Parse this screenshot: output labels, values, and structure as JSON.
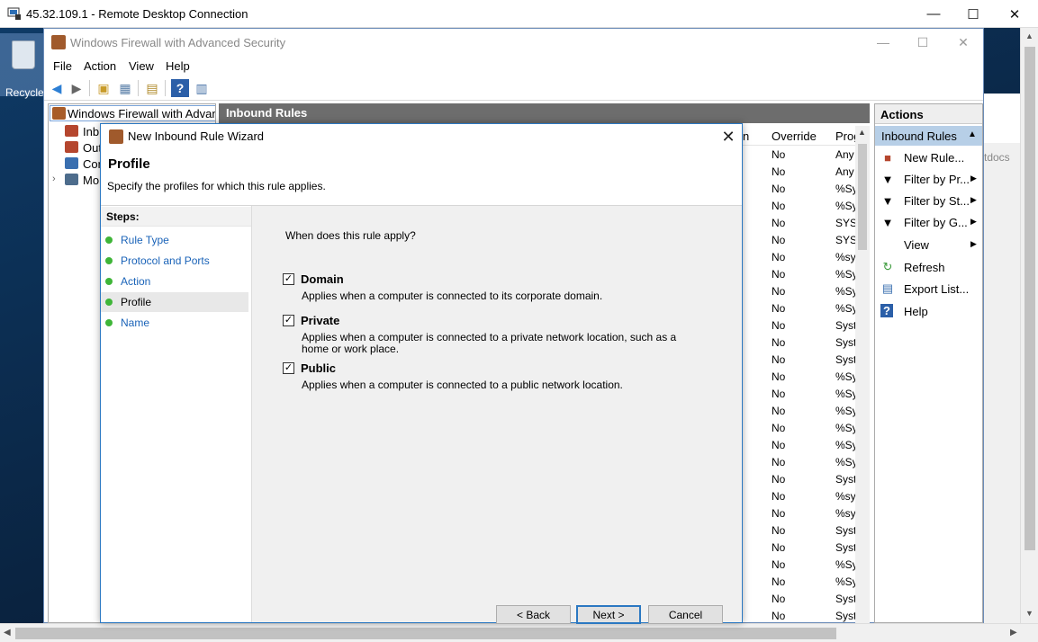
{
  "rdp": {
    "title": "45.32.109.1 - Remote Desktop Connection",
    "min": "—",
    "max": "☐",
    "close": "✕"
  },
  "desktop": {
    "recycle_label": "Recycle",
    "right_strip_text": "tdocs"
  },
  "mmc": {
    "title": "Windows Firewall with Advanced Security",
    "menu": [
      "File",
      "Action",
      "View",
      "Help"
    ],
    "tree": {
      "root": "Windows Firewall with Advance",
      "items": [
        "Inb",
        "Out",
        "Cor",
        "Mo"
      ]
    },
    "center_header": "Inbound Rules",
    "columns": [
      "n",
      "Override",
      "Prog"
    ],
    "rows": [
      [
        "No",
        "Any"
      ],
      [
        "No",
        "Any"
      ],
      [
        "No",
        "%Sy"
      ],
      [
        "No",
        "%Sy"
      ],
      [
        "No",
        "SYST"
      ],
      [
        "No",
        "SYST"
      ],
      [
        "No",
        "%sy"
      ],
      [
        "No",
        "%Sy"
      ],
      [
        "No",
        "%Sy"
      ],
      [
        "No",
        "%Sy"
      ],
      [
        "No",
        "Syst"
      ],
      [
        "No",
        "Syst"
      ],
      [
        "No",
        "Syst"
      ],
      [
        "No",
        "%Sy"
      ],
      [
        "No",
        "%Sy"
      ],
      [
        "No",
        "%Sy"
      ],
      [
        "No",
        "%Sy"
      ],
      [
        "No",
        "%Sy"
      ],
      [
        "No",
        "%Sy"
      ],
      [
        "No",
        "Syst"
      ],
      [
        "No",
        "%sy"
      ],
      [
        "No",
        "%sy"
      ],
      [
        "No",
        "Syst"
      ],
      [
        "No",
        "Syst"
      ],
      [
        "No",
        "%Sy"
      ],
      [
        "No",
        "%Sy"
      ],
      [
        "No",
        "Syst"
      ],
      [
        "No",
        "Syst"
      ]
    ],
    "actions": {
      "title": "Actions",
      "section": "Inbound Rules",
      "items": [
        "New Rule...",
        "Filter by Pr...",
        "Filter by St...",
        "Filter by G...",
        "View",
        "Refresh",
        "Export List...",
        "Help"
      ]
    }
  },
  "wizard": {
    "title": "New Inbound Rule Wizard",
    "heading": "Profile",
    "subheading": "Specify the profiles for which this rule applies.",
    "steps_title": "Steps:",
    "steps": [
      "Rule Type",
      "Protocol and Ports",
      "Action",
      "Profile",
      "Name"
    ],
    "current_step": "Profile",
    "question": "When does this rule apply?",
    "options": [
      {
        "label": "Domain",
        "checked": true,
        "desc": "Applies when a computer is connected to its corporate domain."
      },
      {
        "label": "Private",
        "checked": true,
        "desc": "Applies when a computer is connected to a private network location, such as a home or work place."
      },
      {
        "label": "Public",
        "checked": true,
        "desc": "Applies when a computer is connected to a public network location."
      }
    ],
    "buttons": {
      "back": "< Back",
      "next": "Next >",
      "cancel": "Cancel"
    }
  },
  "colors": {
    "accent": "#2b78c2",
    "step_dot": "#3fb538",
    "step_link": "#1a63b8",
    "section_bg": "#b7cfe7",
    "header_bg": "#6d6d6d"
  }
}
